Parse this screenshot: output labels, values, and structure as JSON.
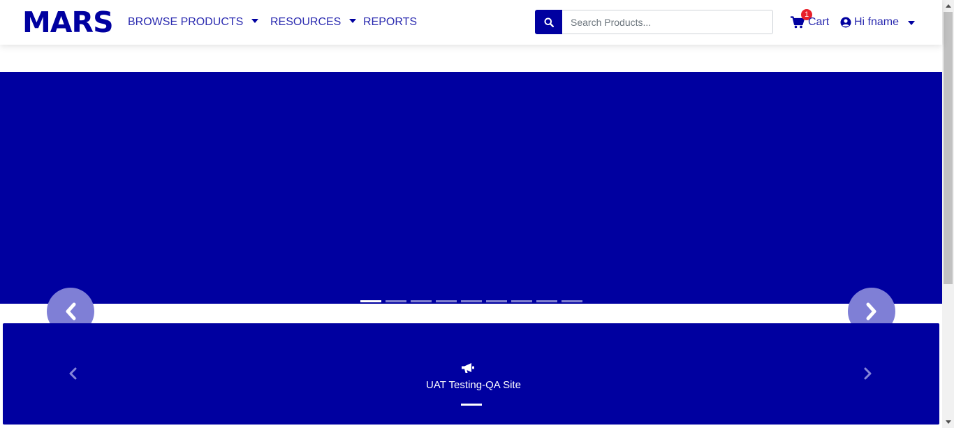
{
  "brand": {
    "logo_text": "MARS",
    "accent_color": "#0000a0"
  },
  "nav": {
    "items": [
      {
        "label": "BROWSE PRODUCTS",
        "has_dropdown": true
      },
      {
        "label": "RESOURCES",
        "has_dropdown": true
      },
      {
        "label": "REPORTS",
        "has_dropdown": false
      }
    ]
  },
  "search": {
    "placeholder": "Search Products...",
    "value": "",
    "icon": "search-icon"
  },
  "cart": {
    "label": "Cart",
    "count": "1",
    "icon": "shopping-cart-icon",
    "badge_color": "#e8202a"
  },
  "user": {
    "greeting": "Hi fname",
    "icon": "user-circle-icon"
  },
  "hero": {
    "background": "#0000a0",
    "slide_count": 9,
    "active_slide": 1
  },
  "announcement": {
    "text": "UAT Testing-QA Site",
    "icon": "megaphone-icon"
  }
}
